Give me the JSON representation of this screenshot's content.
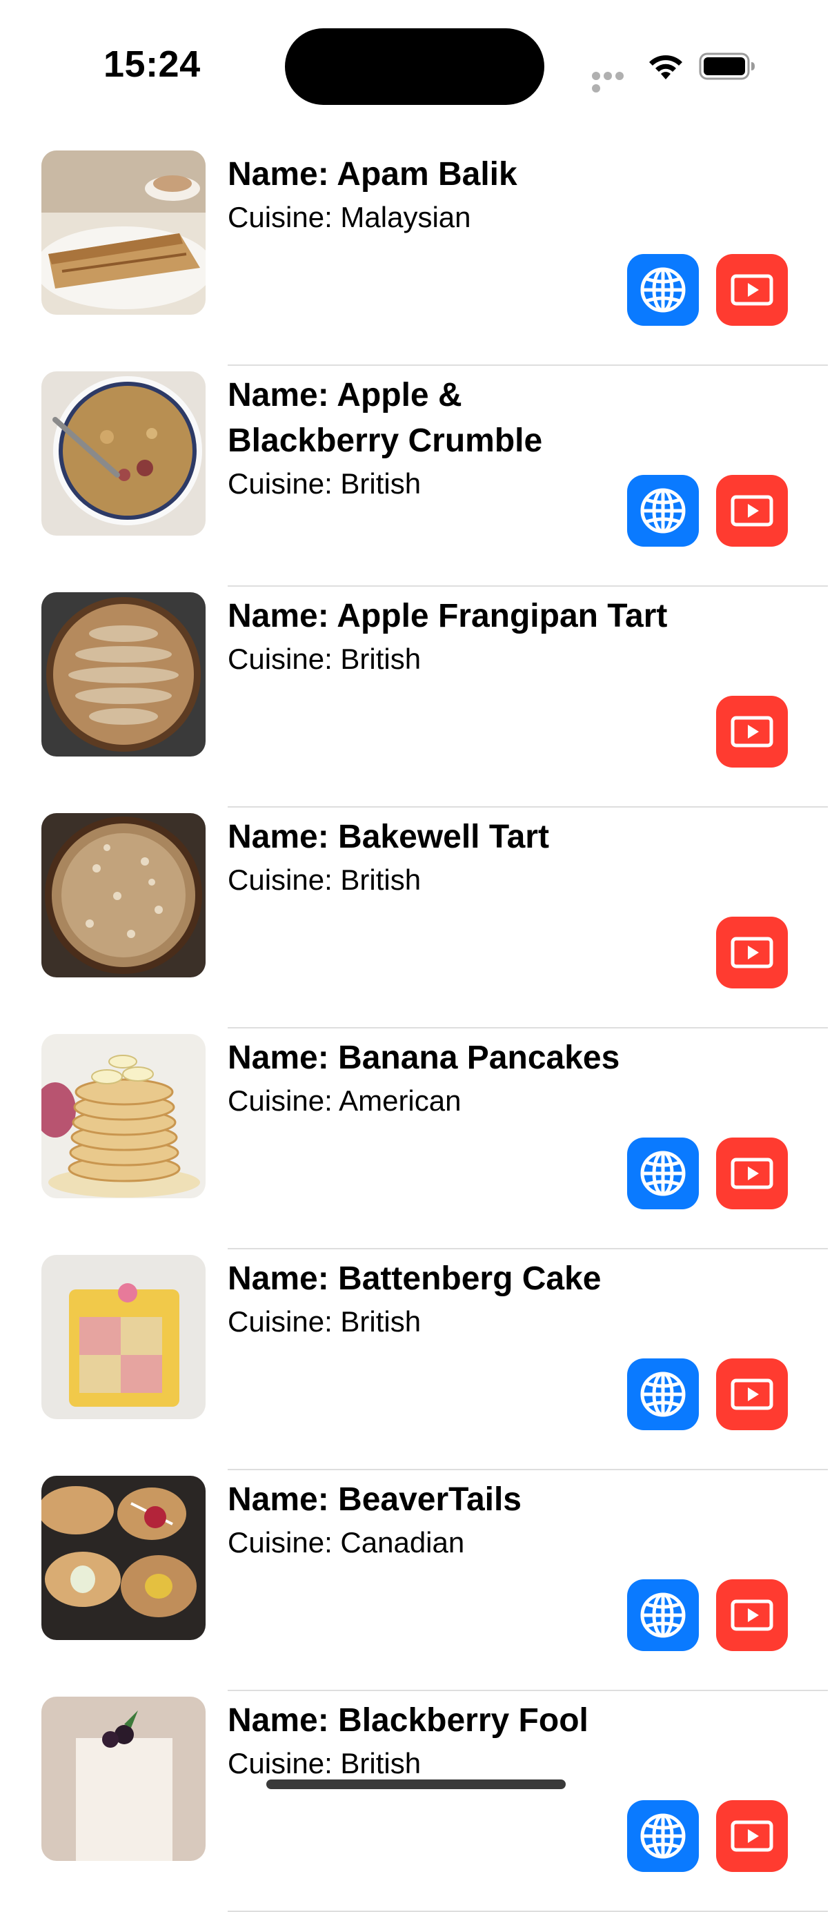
{
  "status_bar": {
    "time": "15:24",
    "icons": [
      "cellular-signal-icon",
      "wifi-icon",
      "battery-icon"
    ]
  },
  "colors": {
    "website_button": "#0A7AFF",
    "youtube_button": "#FF3B30",
    "divider": "#DEDEDE"
  },
  "recipes": [
    {
      "name": "Name: Apam Balik",
      "cuisine": "Cuisine: Malaysian",
      "has_website": true,
      "has_youtube": true,
      "thumbnail": "apam-balik-photo"
    },
    {
      "name": "Name: Apple & Blackberry Crumble",
      "cuisine": "Cuisine: British",
      "has_website": true,
      "has_youtube": true,
      "thumbnail": "crumble-photo"
    },
    {
      "name": "Name: Apple Frangipan Tart",
      "cuisine": "Cuisine: British",
      "has_website": false,
      "has_youtube": true,
      "thumbnail": "frangipan-tart-photo"
    },
    {
      "name": "Name: Bakewell Tart",
      "cuisine": "Cuisine: British",
      "has_website": false,
      "has_youtube": true,
      "thumbnail": "bakewell-tart-photo"
    },
    {
      "name": "Name: Banana Pancakes",
      "cuisine": "Cuisine: American",
      "has_website": true,
      "has_youtube": true,
      "thumbnail": "banana-pancakes-photo"
    },
    {
      "name": "Name: Battenberg Cake",
      "cuisine": "Cuisine: British",
      "has_website": true,
      "has_youtube": true,
      "thumbnail": "battenberg-cake-photo"
    },
    {
      "name": "Name: BeaverTails",
      "cuisine": "Cuisine: Canadian",
      "has_website": true,
      "has_youtube": true,
      "thumbnail": "beavertails-photo"
    },
    {
      "name": "Name: Blackberry Fool",
      "cuisine": "Cuisine: British",
      "has_website": true,
      "has_youtube": true,
      "thumbnail": "blackberry-fool-photo"
    }
  ]
}
